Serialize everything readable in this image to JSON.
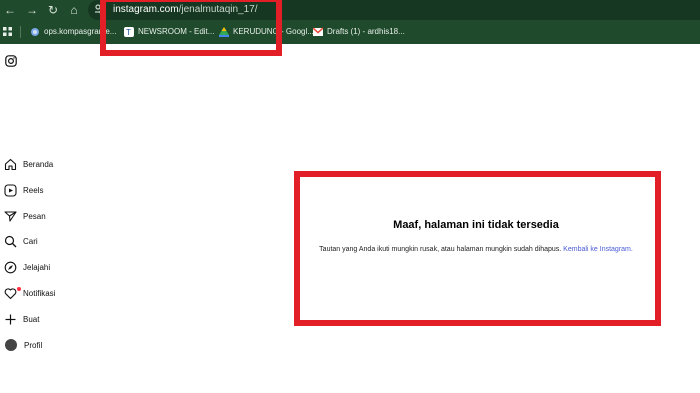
{
  "browser": {
    "url_host": "instagram.com",
    "url_path": "/jenalmutaqin_17/",
    "bookmarks": [
      {
        "label": "ops.kompasgrame...",
        "icon": "globe-icon"
      },
      {
        "label": "NEWSROOM - Edit...",
        "icon": "kompas-icon"
      },
      {
        "label": "KERUDUNG - Googl...",
        "icon": "google-drive-icon"
      },
      {
        "label": "Drafts (1) - ardhis18...",
        "icon": "gmail-icon"
      }
    ]
  },
  "sidebar": {
    "items": [
      {
        "label": "Beranda",
        "icon": "home-icon"
      },
      {
        "label": "Reels",
        "icon": "reels-icon"
      },
      {
        "label": "Pesan",
        "icon": "messages-icon"
      },
      {
        "label": "Cari",
        "icon": "search-icon"
      },
      {
        "label": "Jelajahi",
        "icon": "explore-icon"
      },
      {
        "label": "Notifikasi",
        "icon": "heart-icon"
      },
      {
        "label": "Buat",
        "icon": "plus-icon"
      },
      {
        "label": "Profil",
        "icon": "avatar"
      }
    ]
  },
  "main": {
    "title": "Maaf, halaman ini tidak tersedia",
    "body_text": "Tautan yang Anda ikuti mungkin rusak, atau halaman mungkin sudah dihapus.",
    "link_text": "Kembali ke Instagram."
  },
  "colors": {
    "toolbar": "#1f4a2c",
    "annotation": "#e21f26",
    "link": "#4a5bd8"
  }
}
